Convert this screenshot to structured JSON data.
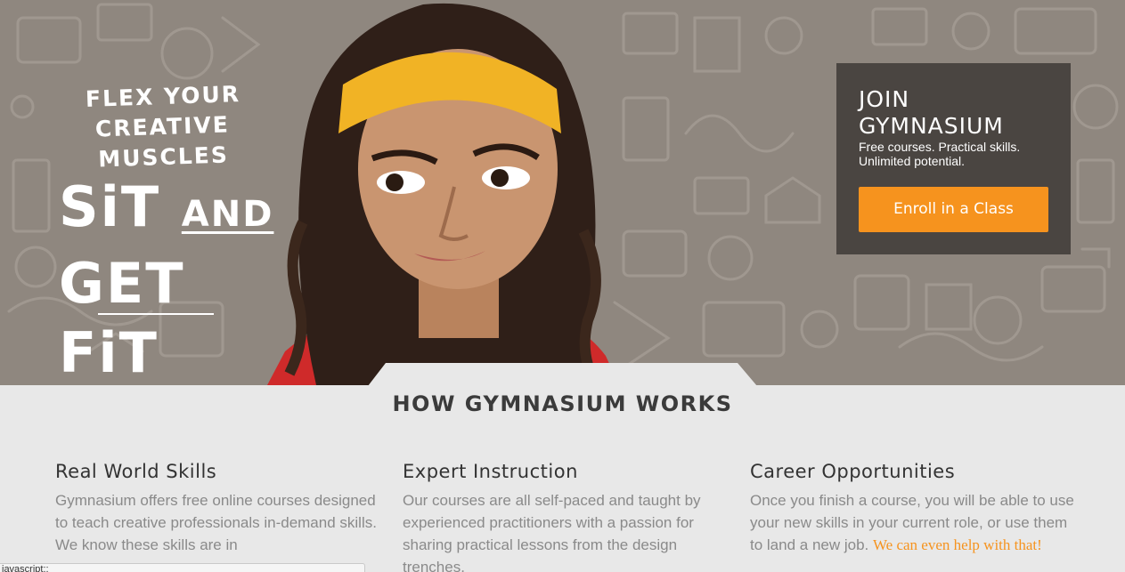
{
  "hero": {
    "tagline_line1": "FLEX YOUR",
    "tagline_line2": "CREATIVE MUSCLES",
    "tagline_sit": "SiT",
    "tagline_and": "AND",
    "tagline_get_fit": "GET FiT"
  },
  "join": {
    "title_line1": "JOIN",
    "title_line2": "GYMNASIUM",
    "subtitle": "Free courses. Practical skills. Unlimited potential.",
    "button_label": "Enroll in a Class"
  },
  "how": {
    "title": "HOW GYMNASIUM WORKS",
    "features": [
      {
        "title": "Real World Skills",
        "text": "Gymnasium offers free online courses designed to teach creative professionals in-demand skills. We know these skills are in",
        "link": ""
      },
      {
        "title": "Expert Instruction",
        "text": "Our courses are all self-paced and taught by experienced practitioners with a passion for sharing practical lessons from the design trenches.",
        "link": ""
      },
      {
        "title": "Career Opportunities",
        "text": "Once you finish a course, you will be able to use your new skills in your current role, or use them to land a new job. ",
        "link": "We can even help with that!"
      }
    ]
  },
  "statusbar": {
    "text": "javascript:;"
  },
  "colors": {
    "accent": "#f6931e",
    "hero_bg": "#8f877f",
    "join_box": "#4a4541",
    "headband": "#f1b325"
  }
}
